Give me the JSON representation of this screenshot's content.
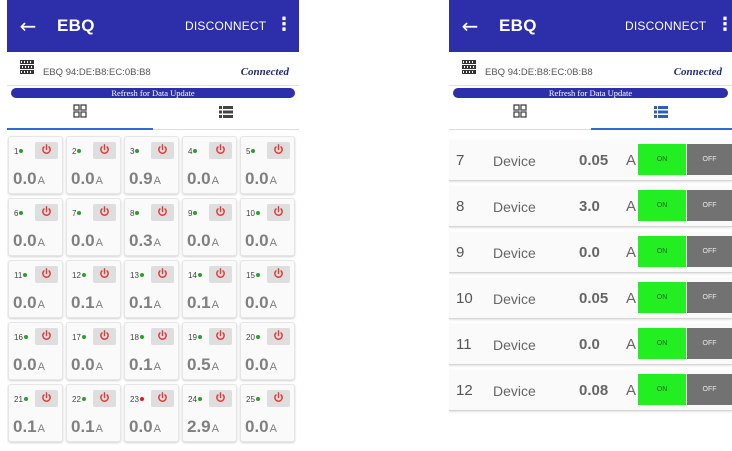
{
  "app": {
    "title": "EBQ",
    "disconnect_label": "DISCONNECT",
    "device_name": "EBQ  94:DE:B8:EC:0B:B8",
    "status": "Connected",
    "refresh_label": "Refresh for Data Update"
  },
  "colors": {
    "appbar": "#2d2eaa",
    "active_tab": "#2d6bd8",
    "on_button": "#22ee22",
    "off_button": "#727272",
    "power_icon": "#e53935",
    "dot_green": "#2e9e2e",
    "dot_red": "#d32020"
  },
  "icons": {
    "back": "arrow-left-icon",
    "menu": "kebab-menu-icon",
    "device": "device-module-icon",
    "grid_tab": "grid-view-icon",
    "list_tab": "list-view-icon",
    "power": "power-icon"
  },
  "grid_view": {
    "active_tab": "grid",
    "cells": [
      {
        "num": "1",
        "dot": "green",
        "value": "0.0",
        "unit": "A"
      },
      {
        "num": "2",
        "dot": "green",
        "value": "0.0",
        "unit": "A"
      },
      {
        "num": "3",
        "dot": "green",
        "value": "0.9",
        "unit": "A"
      },
      {
        "num": "4",
        "dot": "green",
        "value": "0.0",
        "unit": "A"
      },
      {
        "num": "5",
        "dot": "green",
        "value": "0.0",
        "unit": "A"
      },
      {
        "num": "6",
        "dot": "green",
        "value": "0.0",
        "unit": "A"
      },
      {
        "num": "7",
        "dot": "green",
        "value": "0.0",
        "unit": "A"
      },
      {
        "num": "8",
        "dot": "green",
        "value": "0.3",
        "unit": "A"
      },
      {
        "num": "9",
        "dot": "green",
        "value": "0.0",
        "unit": "A"
      },
      {
        "num": "10",
        "dot": "green",
        "value": "0.0",
        "unit": "A"
      },
      {
        "num": "11",
        "dot": "green",
        "value": "0.0",
        "unit": "A"
      },
      {
        "num": "12",
        "dot": "green",
        "value": "0.1",
        "unit": "A"
      },
      {
        "num": "13",
        "dot": "green",
        "value": "0.1",
        "unit": "A"
      },
      {
        "num": "14",
        "dot": "green",
        "value": "0.1",
        "unit": "A"
      },
      {
        "num": "15",
        "dot": "green",
        "value": "0.0",
        "unit": "A"
      },
      {
        "num": "16",
        "dot": "green",
        "value": "0.0",
        "unit": "A"
      },
      {
        "num": "17",
        "dot": "green",
        "value": "0.0",
        "unit": "A"
      },
      {
        "num": "18",
        "dot": "green",
        "value": "0.1",
        "unit": "A"
      },
      {
        "num": "19",
        "dot": "green",
        "value": "0.5",
        "unit": "A"
      },
      {
        "num": "20",
        "dot": "green",
        "value": "0.0",
        "unit": "A"
      },
      {
        "num": "21",
        "dot": "green",
        "value": "0.1",
        "unit": "A"
      },
      {
        "num": "22",
        "dot": "green",
        "value": "0.1",
        "unit": "A"
      },
      {
        "num": "23",
        "dot": "red",
        "value": "0.0",
        "unit": "A"
      },
      {
        "num": "24",
        "dot": "green",
        "value": "2.9",
        "unit": "A"
      },
      {
        "num": "25",
        "dot": "green",
        "value": "0.0",
        "unit": "A"
      }
    ]
  },
  "list_view": {
    "active_tab": "list",
    "rows": [
      {
        "num": "7",
        "name": "Device",
        "value": "0.05",
        "unit": "A",
        "on_label": "ON",
        "off_label": "OFF"
      },
      {
        "num": "8",
        "name": "Device",
        "value": "3.0",
        "unit": "A",
        "on_label": "ON",
        "off_label": "OFF"
      },
      {
        "num": "9",
        "name": "Device",
        "value": "0.0",
        "unit": "A",
        "on_label": "ON",
        "off_label": "OFF"
      },
      {
        "num": "10",
        "name": "Device",
        "value": "0.05",
        "unit": "A",
        "on_label": "ON",
        "off_label": "OFF"
      },
      {
        "num": "11",
        "name": "Device",
        "value": "0.0",
        "unit": "A",
        "on_label": "ON",
        "off_label": "OFF"
      },
      {
        "num": "12",
        "name": "Device",
        "value": "0.08",
        "unit": "A",
        "on_label": "ON",
        "off_label": "OFF"
      }
    ]
  }
}
